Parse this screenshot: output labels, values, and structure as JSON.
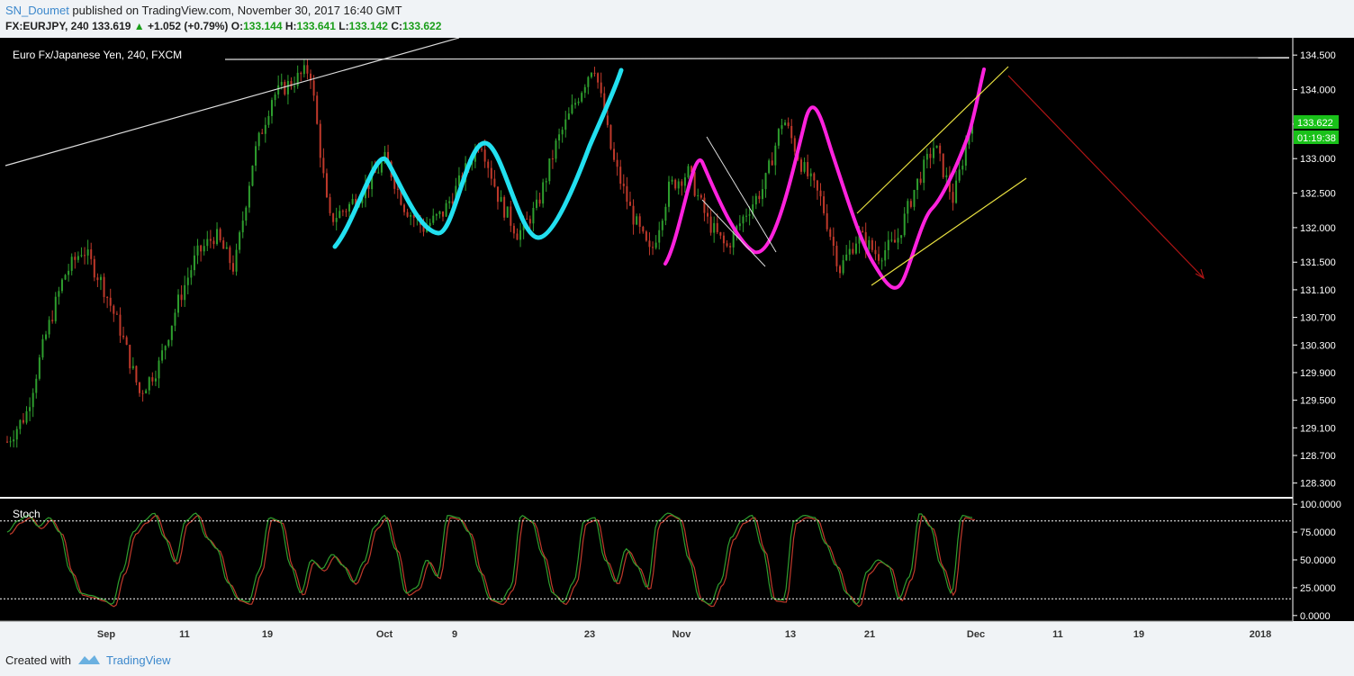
{
  "header": {
    "user": "SN_Doumet",
    "published_text": " published on TradingView.com, November 30, 2017 16:40 GMT",
    "symbol": "FX:EURJPY, 240",
    "last": "133.619",
    "change_arrow": "▲",
    "change": "+1.052 (+0.79%)",
    "o_label": "O:",
    "o_val": "133.144",
    "h_label": "H:",
    "h_val": "133.641",
    "l_label": "L:",
    "l_val": "133.142",
    "c_label": "C:",
    "c_val": "133.622"
  },
  "chart_title": "Euro Fx/Japanese Yen, 240, FXCM",
  "footer": {
    "created": "Created with",
    "brand": "TradingView"
  },
  "colors": {
    "bg": "#000000",
    "up": "#2e9e2e",
    "down": "#c0392b",
    "cyan": "#22e0f0",
    "magenta": "#ff22dd",
    "yellow": "#e8e040",
    "red": "#b01515",
    "price_badge": "#19c119"
  },
  "chart_data": [
    {
      "type": "candlestick",
      "title": "Euro Fx/Japanese Yen, 240, FXCM",
      "x_tick_labels": [
        "Sep",
        "11",
        "19",
        "Oct",
        "9",
        "23",
        "Nov",
        "13",
        "21",
        "Dec",
        "11",
        "19",
        "2018"
      ],
      "y_tick_labels": [
        "134.500",
        "134.000",
        "133.500",
        "133.000",
        "132.500",
        "132.000",
        "131.500",
        "131.100",
        "130.700",
        "130.300",
        "129.900",
        "129.500",
        "129.100",
        "128.700",
        "128.300"
      ],
      "y_range": [
        128.1,
        134.75
      ],
      "last_price": "133.622",
      "countdown": "01:19:38",
      "close_path": [
        128.9,
        129.3,
        130.4,
        131.3,
        131.7,
        131.2,
        130.5,
        129.6,
        130.0,
        130.9,
        131.6,
        131.9,
        131.4,
        133.0,
        133.9,
        134.1,
        134.3,
        132.1,
        132.3,
        132.6,
        133.0,
        132.3,
        132.0,
        132.2,
        132.7,
        133.3,
        132.4,
        131.9,
        132.3,
        133.2,
        133.8,
        134.4,
        133.0,
        132.2,
        131.6,
        132.6,
        132.8,
        132.1,
        131.7,
        132.2,
        132.6,
        133.6,
        132.9,
        132.4,
        131.4,
        131.9,
        131.6,
        131.8,
        132.6,
        133.2,
        132.4,
        133.6
      ]
    },
    {
      "type": "line",
      "title": "Stoch",
      "y_tick_labels": [
        "100.0000",
        "75.0000",
        "50.0000",
        "25.0000",
        "0.0000"
      ],
      "y_range": [
        -5,
        105
      ],
      "overbought": 85,
      "oversold": 15,
      "series": [
        {
          "color": "#2e9e2e",
          "values": [
            75,
            85,
            90,
            80,
            88,
            75,
            40,
            20,
            18,
            15,
            10,
            40,
            75,
            85,
            92,
            70,
            48,
            85,
            92,
            70,
            60,
            30,
            15,
            12,
            40,
            88,
            85,
            45,
            20,
            50,
            42,
            55,
            45,
            30,
            48,
            80,
            90,
            60,
            20,
            25,
            50,
            35,
            90,
            88,
            75,
            40,
            15,
            12,
            25,
            90,
            85,
            55,
            20,
            12,
            30,
            85,
            88,
            50,
            30,
            60,
            45,
            25,
            85,
            92,
            88,
            50,
            15,
            10,
            30,
            70,
            85,
            90,
            60,
            15,
            14,
            85,
            90,
            88,
            65,
            45,
            20,
            10,
            40,
            50,
            45,
            15,
            35,
            92,
            80,
            45,
            20,
            90,
            88
          ]
        }
      ]
    }
  ]
}
